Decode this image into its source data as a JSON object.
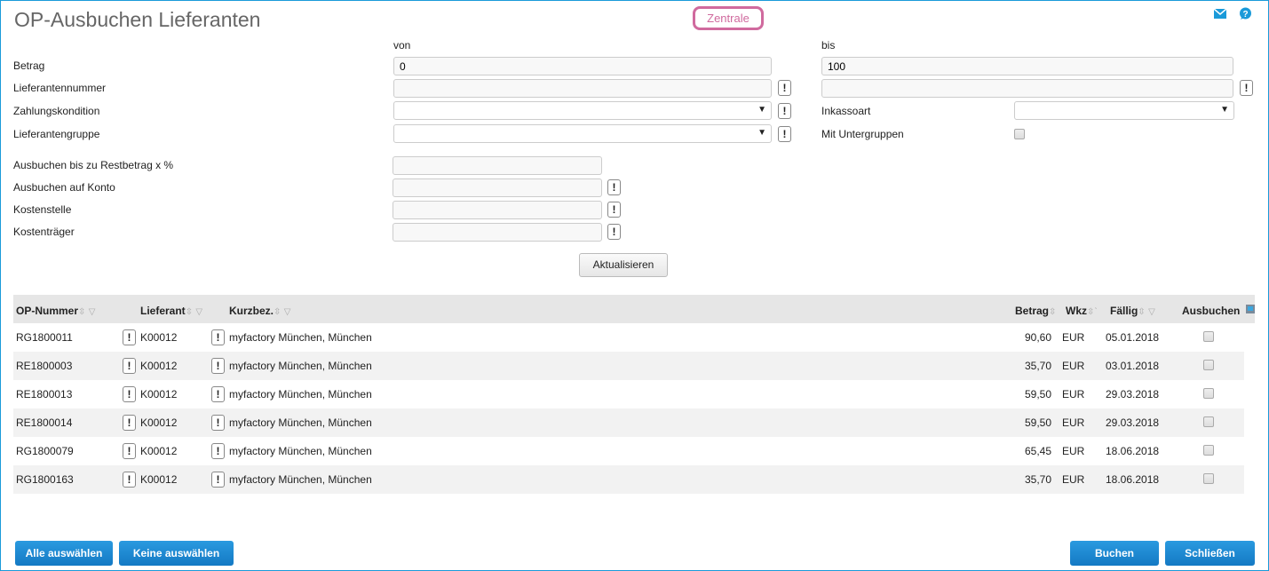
{
  "title": "OP-Ausbuchen Lieferanten",
  "badge": "Zentrale",
  "form": {
    "von": "von",
    "bis": "bis",
    "betrag": "Betrag",
    "betrag_von": "0",
    "betrag_bis": "100",
    "lieferantennummer": "Lieferantennummer",
    "zahlungskondition": "Zahlungskondition",
    "inkassoart": "Inkassoart",
    "lieferantengruppe": "Lieferantengruppe",
    "mit_untergruppen": "Mit Untergruppen",
    "ausbuchen_bis": "Ausbuchen bis zu Restbetrag x %",
    "ausbuchen_konto": "Ausbuchen auf Konto",
    "kostenstelle": "Kostenstelle",
    "kostentraeger": "Kostenträger",
    "exclaim": "!"
  },
  "refresh": "Aktualisieren",
  "table": {
    "headers": {
      "op": "OP-Nummer",
      "lieferant": "Lieferant",
      "kurz": "Kurzbez.",
      "betrag": "Betrag",
      "wkz": "Wkz",
      "faellig": "Fällig",
      "ausbuchen": "Ausbuchen"
    },
    "rows": [
      {
        "op": "RG1800011",
        "lieferant": "K00012",
        "kurz": "myfactory München, München",
        "betrag": "90,60",
        "wkz": "EUR",
        "faellig": "05.01.2018"
      },
      {
        "op": "RE1800003",
        "lieferant": "K00012",
        "kurz": "myfactory München, München",
        "betrag": "35,70",
        "wkz": "EUR",
        "faellig": "03.01.2018"
      },
      {
        "op": "RE1800013",
        "lieferant": "K00012",
        "kurz": "myfactory München, München",
        "betrag": "59,50",
        "wkz": "EUR",
        "faellig": "29.03.2018"
      },
      {
        "op": "RE1800014",
        "lieferant": "K00012",
        "kurz": "myfactory München, München",
        "betrag": "59,50",
        "wkz": "EUR",
        "faellig": "29.03.2018"
      },
      {
        "op": "RG1800079",
        "lieferant": "K00012",
        "kurz": "myfactory München, München",
        "betrag": "65,45",
        "wkz": "EUR",
        "faellig": "18.06.2018"
      },
      {
        "op": "RG1800163",
        "lieferant": "K00012",
        "kurz": "myfactory München, München",
        "betrag": "35,70",
        "wkz": "EUR",
        "faellig": "18.06.2018"
      }
    ]
  },
  "footer": {
    "alle": "Alle auswählen",
    "keine": "Keine auswählen",
    "buchen": "Buchen",
    "schliessen": "Schließen"
  }
}
